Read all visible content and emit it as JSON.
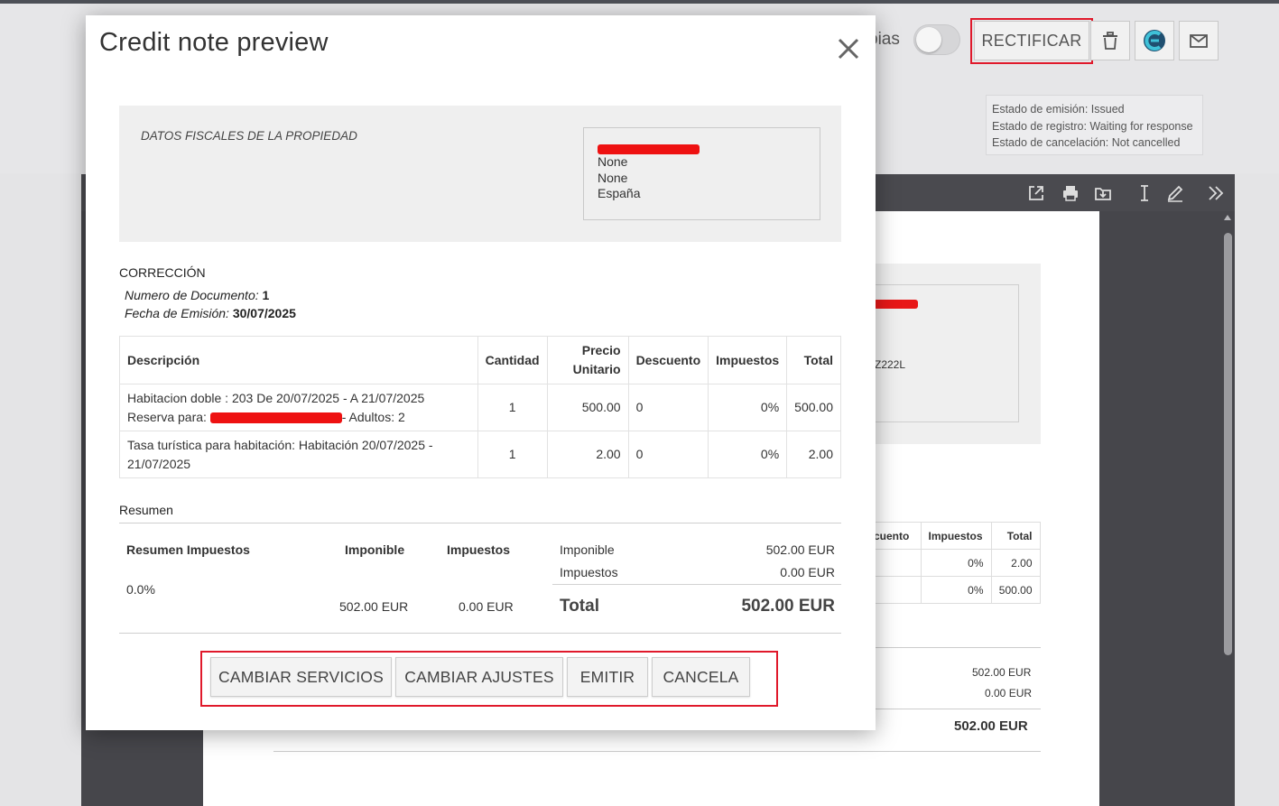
{
  "background": {
    "toggle_label": "pias",
    "rectificar_label": "RECTIFICAR",
    "icons": [
      "trash-icon",
      "brand-logo-icon",
      "mail-icon"
    ],
    "status": [
      "Estado de emisión: Issued",
      "Estado de registro: Waiting for response",
      "Estado de cancelación: Not cancelled"
    ],
    "viewer_icons": [
      "open-external-icon",
      "print-icon",
      "download-icon",
      "text-cursor-icon",
      "pencil-icon",
      "double-chevron-right-icon"
    ],
    "doc": {
      "partial_id": "Z222L",
      "table_headers": [
        "cuento",
        "Impuestos",
        "Total"
      ],
      "table_rows": [
        [
          "",
          "0%",
          "2.00"
        ],
        [
          "",
          "0%",
          "500.00"
        ]
      ],
      "imponible": "502.00 EUR",
      "impuestos": "0.00 EUR",
      "total": "502.00 EUR"
    }
  },
  "modal": {
    "title": "Credit note preview",
    "fiscal_label": "DATOS FISCALES DE LA PROPIEDAD",
    "address_lines": [
      "None",
      "None",
      "España"
    ],
    "correction": {
      "title": "CORRECCIÓN",
      "doc_number_label": "Numero de Documento:",
      "doc_number": "1",
      "date_label": "Fecha de Emisión:",
      "date": "30/07/2025"
    },
    "items_headers": {
      "descripcion": "Descripción",
      "cantidad": "Cantidad",
      "precio_1": "Precio",
      "precio_2": "Unitario",
      "descuento": "Descuento",
      "impuestos": "Impuestos",
      "total": "Total"
    },
    "items": [
      {
        "desc_line1": "Habitacion doble : 203 De 20/07/2025 - A 21/07/2025",
        "desc_line2_prefix": "Reserva para:",
        "desc_line2_suffix": "- Adultos: 2",
        "cantidad": "1",
        "precio": "500.00",
        "descuento": "0",
        "impuestos": "0%",
        "total": "500.00"
      },
      {
        "desc_line1": "Tasa turística para habitación: Habitación 20/07/2025 -",
        "desc_line2": "21/07/2025",
        "cantidad": "1",
        "precio": "2.00",
        "descuento": "0",
        "impuestos": "0%",
        "total": "2.00"
      }
    ],
    "summary": {
      "title": "Resumen",
      "tax_header": "Resumen Impuestos",
      "imponible_header": "Imponible",
      "impuestos_header": "Impuestos",
      "tax_rate": "0.0%",
      "tax_imponible": "502.00 EUR",
      "tax_impuestos": "0.00 EUR",
      "imponible_label": "Imponible",
      "imponible_value": "502.00 EUR",
      "impuestos_label": "Impuestos",
      "impuestos_value": "0.00 EUR",
      "total_label": "Total",
      "total_value": "502.00 EUR"
    },
    "actions": {
      "cambiar_servicios": "CAMBIAR SERVICIOS",
      "cambiar_ajustes": "CAMBIAR AJUSTES",
      "emitir": "EMITIR",
      "cancela": "CANCELA"
    },
    "colors": {
      "highlight": "#e0192b",
      "redaction": "#ee1111"
    }
  }
}
